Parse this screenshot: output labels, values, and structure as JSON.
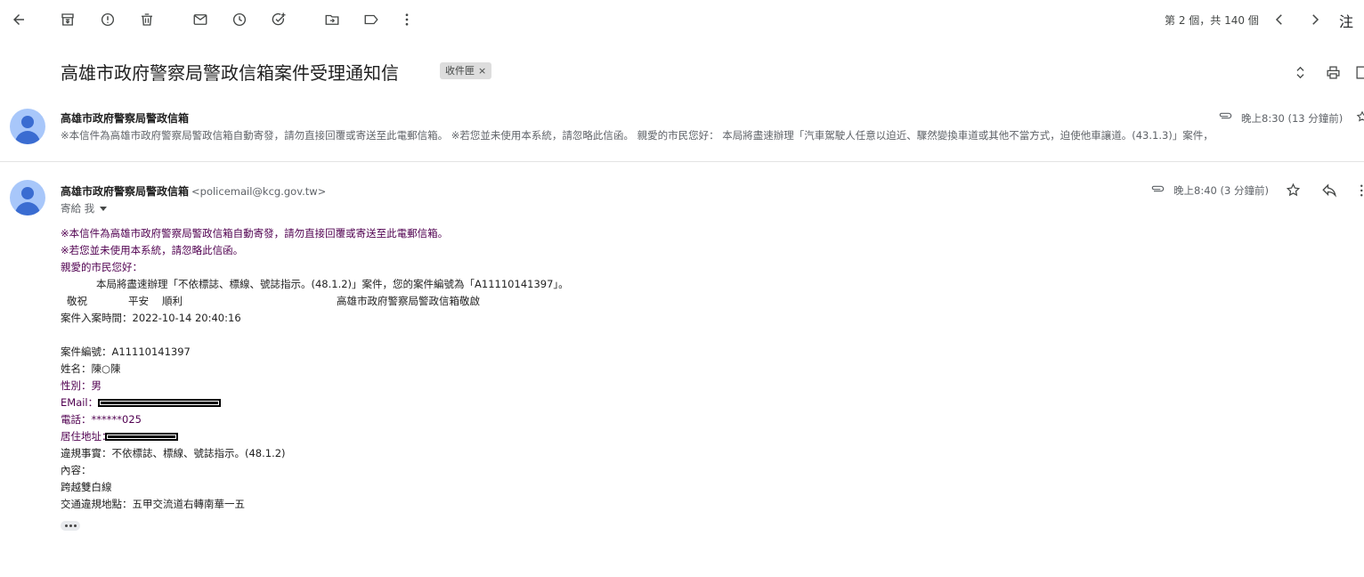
{
  "toolbar": {
    "pager": "第 2 個，共 140 個",
    "lang": "注"
  },
  "subject": {
    "title": "高雄市政府警察局警政信箱案件受理通知信",
    "label": "收件匣",
    "label_close": "×"
  },
  "thread": [
    {
      "sender": "高雄市政府警察局警政信箱",
      "snippet": "※本信件為高雄市政府警察局警政信箱自動寄發，請勿直接回覆或寄送至此電郵信箱。 ※若您並未使用本系統，請忽略此信函。 親愛的市民您好： 本局將盡速辦理「汽車駕駛人任意以迫近、驟然變換車道或其他不當方式，迫使他車讓道。(43.1.3)」案件，",
      "time": "晚上8:30 (13 分鐘前)"
    },
    {
      "sender": "高雄市政府警察局警政信箱",
      "email": "<policemail@kcg.gov.tw>",
      "to": "寄給 我",
      "time": "晚上8:40 (3 分鐘前)",
      "body": {
        "l1": "※本信件為高雄市政府警察局警政信箱自動寄發，請勿直接回覆或寄送至此電郵信箱。",
        "l2": "※若您並未使用本系統，請忽略此信函。",
        "l3": "親愛的市民您好：",
        "l4": "本局將盡速辦理「不依標誌、標線、號誌指示。(48.1.2)」案件，您的案件編號為「A11110141397」。",
        "l5a": "敬祝",
        "l5b": "平安",
        "l5c": "順利",
        "l5d": "高雄市政府警察局警政信箱敬啟",
        "l6": "案件入案時間：2022-10-14 20:40:16",
        "l7": "案件編號：A11110141397",
        "l8": "姓名：陳○陳",
        "l9": "性別：男",
        "l10": "EMail：",
        "l11": "電話：******025",
        "l12": "居住地址：",
        "l13": "違規事實：不依標誌、標線、號誌指示。(48.1.2)",
        "l14": "內容：",
        "l15": "跨越雙白線",
        "l16": "交通違規地點：五甲交流道右轉南華一五"
      }
    }
  ],
  "icons": [
    "arrow-left-icon",
    "archive-icon",
    "report-spam-icon",
    "trash-icon",
    "mail-icon",
    "clock-icon",
    "add-task-icon",
    "move-to-icon",
    "label-icon",
    "more-vert-icon",
    "chevron-left-icon",
    "chevron-right-icon",
    "expand-icon",
    "print-icon",
    "open-new-icon",
    "paperclip-icon",
    "star-icon",
    "reply-icon"
  ]
}
